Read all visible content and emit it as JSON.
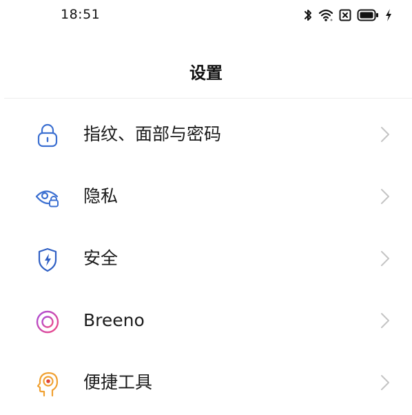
{
  "status_bar": {
    "time": "18:51",
    "icons": [
      "bluetooth-icon",
      "wifi-icon",
      "sim-off-icon",
      "battery-icon",
      "charging-icon"
    ]
  },
  "header": {
    "title": "设置"
  },
  "settings": {
    "items": [
      {
        "label": "指纹、面部与密码",
        "icon": "lock-icon",
        "color": "#3b6fd1"
      },
      {
        "label": "隐私",
        "icon": "privacy-eye-icon",
        "color": "#3b6fd1"
      },
      {
        "label": "安全",
        "icon": "shield-icon",
        "color": "#2f5fc4"
      },
      {
        "label": "Breeno",
        "icon": "breeno-icon",
        "color": "#c341c9"
      },
      {
        "label": "便捷工具",
        "icon": "head-tools-icon",
        "color": "#f0a030"
      }
    ]
  },
  "colors": {
    "chevron": "#c4c4c4",
    "divider": "#ececec"
  }
}
